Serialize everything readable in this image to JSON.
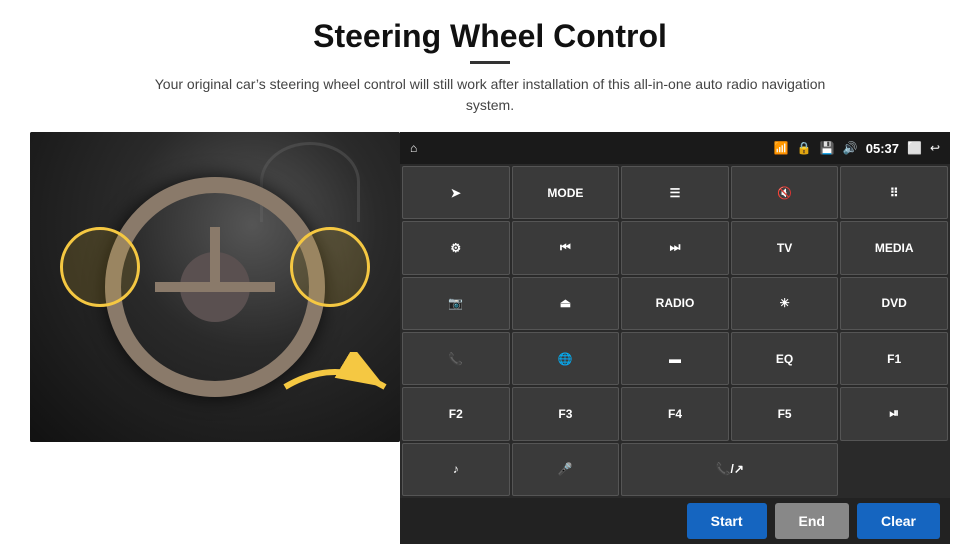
{
  "header": {
    "title": "Steering Wheel Control",
    "subtitle": "Your original car’s steering wheel control will still work after installation of this all-in-one auto radio navigation system."
  },
  "status_bar": {
    "time": "05:37",
    "home_icon": "⌂",
    "wifi_icon": "▾",
    "bluetooth_icon": "▾",
    "nav_back_icon": "←"
  },
  "control_buttons": [
    {
      "id": "nav",
      "label": "→",
      "type": "icon"
    },
    {
      "id": "mode",
      "label": "MODE",
      "type": "text"
    },
    {
      "id": "menu",
      "label": "☰",
      "type": "icon"
    },
    {
      "id": "mute",
      "label": "🔇×",
      "type": "icon"
    },
    {
      "id": "apps",
      "label": "…",
      "type": "icon"
    },
    {
      "id": "settings",
      "label": "⚙",
      "type": "icon"
    },
    {
      "id": "prev",
      "label": "⏮",
      "type": "icon"
    },
    {
      "id": "next",
      "label": "⏭",
      "type": "icon"
    },
    {
      "id": "tv",
      "label": "TV",
      "type": "text"
    },
    {
      "id": "media",
      "label": "MEDIA",
      "type": "text"
    },
    {
      "id": "cam360",
      "label": "360□",
      "type": "icon"
    },
    {
      "id": "eject",
      "label": "⏏",
      "type": "icon"
    },
    {
      "id": "radio",
      "label": "RADIO",
      "type": "text"
    },
    {
      "id": "brightness",
      "label": "☀",
      "type": "icon"
    },
    {
      "id": "dvd",
      "label": "DVD",
      "type": "text"
    },
    {
      "id": "phone",
      "label": "☎",
      "type": "icon"
    },
    {
      "id": "ie",
      "label": "ⓔ",
      "type": "icon"
    },
    {
      "id": "window",
      "label": "☐",
      "type": "icon"
    },
    {
      "id": "eq",
      "label": "EQ",
      "type": "text"
    },
    {
      "id": "f1",
      "label": "F1",
      "type": "text"
    },
    {
      "id": "f2",
      "label": "F2",
      "type": "text"
    },
    {
      "id": "f3",
      "label": "F3",
      "type": "text"
    },
    {
      "id": "f4",
      "label": "F4",
      "type": "text"
    },
    {
      "id": "f5",
      "label": "F5",
      "type": "text"
    },
    {
      "id": "play-pause",
      "label": "⏯",
      "type": "icon"
    },
    {
      "id": "music",
      "label": "♫",
      "type": "icon"
    },
    {
      "id": "mic",
      "label": "🎤",
      "type": "icon"
    },
    {
      "id": "call",
      "label": "📞/↗",
      "type": "icon"
    }
  ],
  "action_bar": {
    "start_label": "Start",
    "end_label": "End",
    "clear_label": "Clear"
  },
  "colors": {
    "panel_bg": "#2a2a2a",
    "button_bg": "#3a3a3a",
    "status_bar_bg": "#1a1a1a",
    "action_blue": "#1565c0",
    "action_gray": "#888",
    "accent_yellow": "#f5c842"
  }
}
